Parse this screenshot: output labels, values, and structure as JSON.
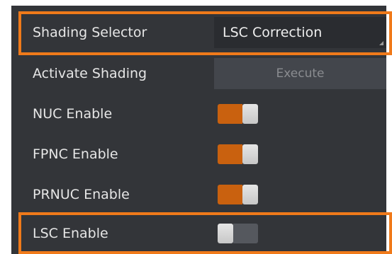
{
  "panel": {
    "colors": {
      "background": "#333539",
      "highlight": "#f07a1a",
      "toggle_on": "#c9610f",
      "toggle_off": "#55585e"
    },
    "rows": [
      {
        "label": "Shading Selector",
        "control": "dropdown",
        "value": "LSC Correction"
      },
      {
        "label": "Activate Shading",
        "control": "button",
        "button_label": "Execute"
      },
      {
        "label": "NUC Enable",
        "control": "toggle",
        "state": "on"
      },
      {
        "label": "FPNC Enable",
        "control": "toggle",
        "state": "on"
      },
      {
        "label": "PRNUC Enable",
        "control": "toggle",
        "state": "on"
      },
      {
        "label": "LSC Enable",
        "control": "toggle",
        "state": "off"
      }
    ]
  }
}
